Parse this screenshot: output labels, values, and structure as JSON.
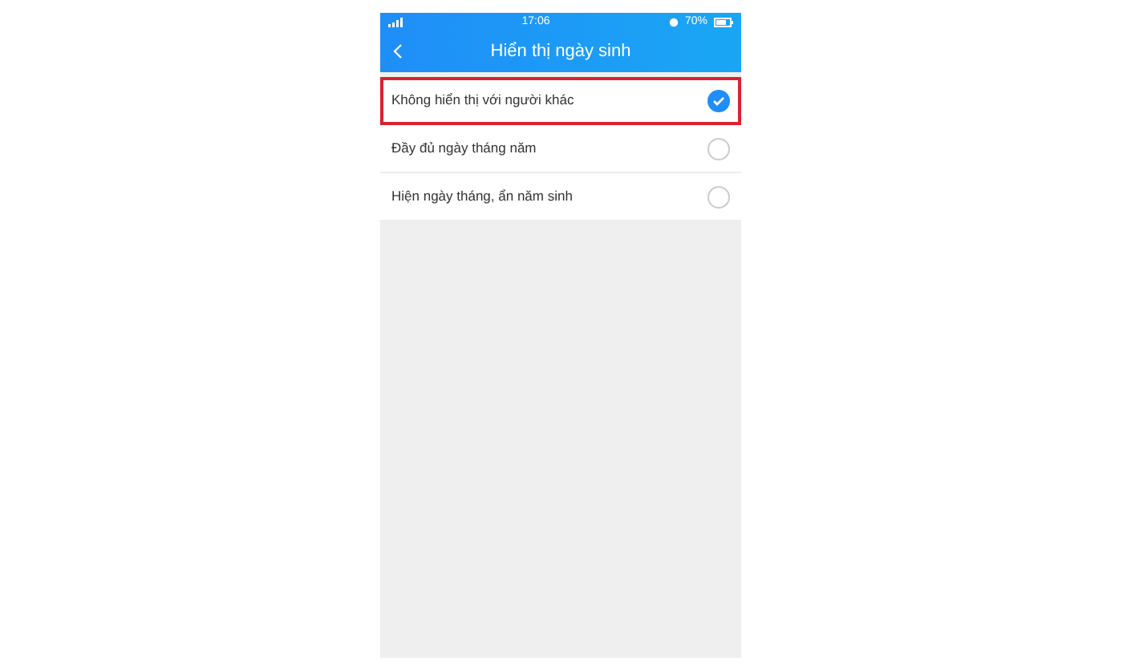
{
  "status_bar": {
    "time": "17:06",
    "battery_text": "70%"
  },
  "header": {
    "title": "Hiển thị ngày sinh"
  },
  "options": [
    {
      "label": "Không hiển thị với người khác",
      "selected": true,
      "highlighted": true
    },
    {
      "label": "Đầy đủ ngày tháng năm",
      "selected": false,
      "highlighted": false
    },
    {
      "label": "Hiện ngày tháng, ẩn năm sinh",
      "selected": false,
      "highlighted": false
    }
  ]
}
